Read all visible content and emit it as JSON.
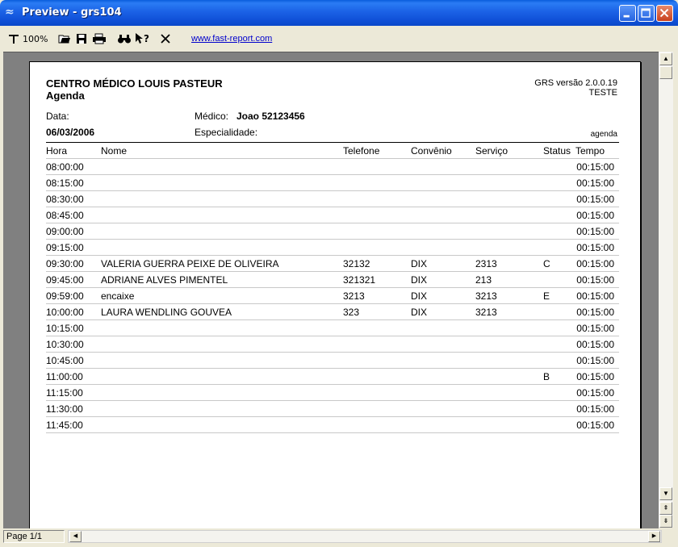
{
  "window": {
    "title": "Preview - grs104"
  },
  "toolbar": {
    "zoom_label": "100%",
    "link": "www.fast-report.com"
  },
  "status": {
    "page": "Page 1/1"
  },
  "report": {
    "clinic": "CENTRO MÉDICO LOUIS PASTEUR",
    "subtitle": "Agenda",
    "version": "GRS versão 2.0.0.19",
    "env": "TESTE",
    "data_label": "Data:",
    "date": "06/03/2006",
    "medico_label": "Médico:",
    "medico": "Joao 52123456",
    "especialidade_label": "Especialidade:",
    "tag": "agenda",
    "columns": [
      "Hora",
      "Nome",
      "Telefone",
      "Convênio",
      "Serviço",
      "Status",
      "Tempo"
    ],
    "rows": [
      {
        "hora": "08:00:00",
        "nome": "",
        "telefone": "",
        "convenio": "",
        "servico": "",
        "status": "",
        "tempo": "00:15:00"
      },
      {
        "hora": "08:15:00",
        "nome": "",
        "telefone": "",
        "convenio": "",
        "servico": "",
        "status": "",
        "tempo": "00:15:00"
      },
      {
        "hora": "08:30:00",
        "nome": "",
        "telefone": "",
        "convenio": "",
        "servico": "",
        "status": "",
        "tempo": "00:15:00"
      },
      {
        "hora": "08:45:00",
        "nome": "",
        "telefone": "",
        "convenio": "",
        "servico": "",
        "status": "",
        "tempo": "00:15:00"
      },
      {
        "hora": "09:00:00",
        "nome": "",
        "telefone": "",
        "convenio": "",
        "servico": "",
        "status": "",
        "tempo": "00:15:00"
      },
      {
        "hora": "09:15:00",
        "nome": "",
        "telefone": "",
        "convenio": "",
        "servico": "",
        "status": "",
        "tempo": "00:15:00"
      },
      {
        "hora": "09:30:00",
        "nome": "VALERIA GUERRA PEIXE DE OLIVEIRA",
        "telefone": "32132",
        "convenio": "DIX",
        "servico": "2313",
        "status": "C",
        "tempo": "00:15:00"
      },
      {
        "hora": "09:45:00",
        "nome": "ADRIANE  ALVES PIMENTEL",
        "telefone": "321321",
        "convenio": "DIX",
        "servico": "213",
        "status": "",
        "tempo": "00:15:00"
      },
      {
        "hora": "09:59:00",
        "nome": "encaixe",
        "telefone": "3213",
        "convenio": "DIX",
        "servico": "3213",
        "status": "E",
        "tempo": "00:15:00"
      },
      {
        "hora": "10:00:00",
        "nome": "LAURA WENDLING GOUVEA",
        "telefone": "323",
        "convenio": "DIX",
        "servico": "3213",
        "status": "",
        "tempo": "00:15:00"
      },
      {
        "hora": "10:15:00",
        "nome": "",
        "telefone": "",
        "convenio": "",
        "servico": "",
        "status": "",
        "tempo": "00:15:00"
      },
      {
        "hora": "10:30:00",
        "nome": "",
        "telefone": "",
        "convenio": "",
        "servico": "",
        "status": "",
        "tempo": "00:15:00"
      },
      {
        "hora": "10:45:00",
        "nome": "",
        "telefone": "",
        "convenio": "",
        "servico": "",
        "status": "",
        "tempo": "00:15:00"
      },
      {
        "hora": "11:00:00",
        "nome": "",
        "telefone": "",
        "convenio": "",
        "servico": "",
        "status": "B",
        "tempo": "00:15:00"
      },
      {
        "hora": "11:15:00",
        "nome": "",
        "telefone": "",
        "convenio": "",
        "servico": "",
        "status": "",
        "tempo": "00:15:00"
      },
      {
        "hora": "11:30:00",
        "nome": "",
        "telefone": "",
        "convenio": "",
        "servico": "",
        "status": "",
        "tempo": "00:15:00"
      },
      {
        "hora": "11:45:00",
        "nome": "",
        "telefone": "",
        "convenio": "",
        "servico": "",
        "status": "",
        "tempo": "00:15:00"
      }
    ]
  },
  "icons": {
    "app": "fastreport-icon",
    "minimize": "minimize-icon",
    "maximize": "maximize-icon",
    "close": "close-icon",
    "zoom": "zoom-icon",
    "open": "open-icon",
    "save": "save-icon",
    "print": "print-icon",
    "find": "find-icon",
    "help": "help-icon",
    "exit": "exit-icon"
  }
}
